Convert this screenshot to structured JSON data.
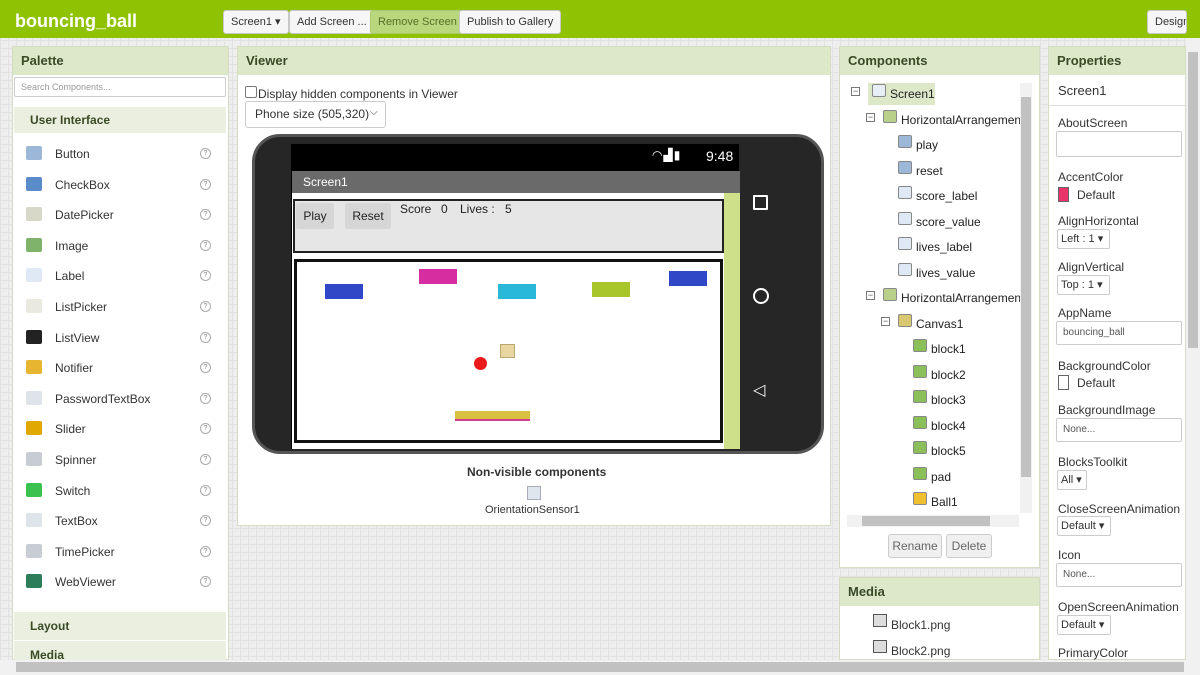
{
  "app": {
    "title": "bouncing_ball",
    "screen_select": "Screen1 ▾",
    "add_screen": "Add Screen ...",
    "remove_screen": "Remove Screen",
    "publish": "Publish to Gallery",
    "designer": "Design"
  },
  "palette": {
    "title": "Palette",
    "search_placeholder": "Search Components...",
    "section": "User Interface",
    "items": [
      {
        "label": "Button",
        "icon": "button-icon",
        "color": "#9db7d9"
      },
      {
        "label": "CheckBox",
        "icon": "checkbox-icon",
        "color": "#5b8cc9"
      },
      {
        "label": "DatePicker",
        "icon": "datepicker-icon",
        "color": "#d8d8c8"
      },
      {
        "label": "Image",
        "icon": "image-icon",
        "color": "#7fb36b"
      },
      {
        "label": "Label",
        "icon": "label-icon",
        "color": "#dfe9f5"
      },
      {
        "label": "ListPicker",
        "icon": "listpicker-icon",
        "color": "#e9e9e0"
      },
      {
        "label": "ListView",
        "icon": "listview-icon",
        "color": "#222222"
      },
      {
        "label": "Notifier",
        "icon": "notifier-icon",
        "color": "#e8b530"
      },
      {
        "label": "PasswordTextBox",
        "icon": "password-icon",
        "color": "#dfe4ea"
      },
      {
        "label": "Slider",
        "icon": "slider-icon",
        "color": "#e0a800"
      },
      {
        "label": "Spinner",
        "icon": "spinner-icon",
        "color": "#c8cdd3"
      },
      {
        "label": "Switch",
        "icon": "switch-icon",
        "color": "#39c24f"
      },
      {
        "label": "TextBox",
        "icon": "textbox-icon",
        "color": "#dfe4ea"
      },
      {
        "label": "TimePicker",
        "icon": "timepicker-icon",
        "color": "#c8cdd3"
      },
      {
        "label": "WebViewer",
        "icon": "webviewer-icon",
        "color": "#2e7d5a"
      }
    ],
    "help_glyph": "?",
    "categories": [
      "Layout",
      "Media"
    ]
  },
  "viewer": {
    "title": "Viewer",
    "checkbox_label": "Display hidden components in Viewer",
    "phone_size": "Phone size (505,320)",
    "status_time": "9:48",
    "screen_title": "Screen1",
    "play": "Play",
    "reset": "Reset",
    "score_label": "Score",
    "score_value": "0",
    "lives_label": "Lives :",
    "lives_value": "5",
    "blocks": [
      {
        "name": "block1",
        "color": "#3048c8"
      },
      {
        "name": "block2",
        "color": "#d62ea0"
      },
      {
        "name": "block3",
        "color": "#2ab8d8"
      },
      {
        "name": "block4",
        "color": "#a8c62a"
      },
      {
        "name": "block5",
        "color": "#3048c8"
      }
    ],
    "ball_color": "#ea1a1a",
    "nonvisible_title": "Non-visible components",
    "orientation_sensor": "OrientationSensor1"
  },
  "components": {
    "title": "Components",
    "tree": [
      {
        "label": "Screen1",
        "level": 0,
        "collapse": "⊟",
        "icon": "screen-icon",
        "selected": true
      },
      {
        "label": "HorizontalArrangemen",
        "level": 1,
        "collapse": "⊟",
        "icon": "arrangement-icon"
      },
      {
        "label": "play",
        "level": 2,
        "icon": "button-icon"
      },
      {
        "label": "reset",
        "level": 2,
        "icon": "button-icon"
      },
      {
        "label": "score_label",
        "level": 2,
        "icon": "label-icon"
      },
      {
        "label": "score_value",
        "level": 2,
        "icon": "label-icon"
      },
      {
        "label": "lives_label",
        "level": 2,
        "icon": "label-icon"
      },
      {
        "label": "lives_value",
        "level": 2,
        "icon": "label-icon"
      },
      {
        "label": "HorizontalArrangemen",
        "level": 1,
        "collapse": "⊟",
        "icon": "arrangement-icon"
      },
      {
        "label": "Canvas1",
        "level": 2,
        "collapse": "⊟",
        "icon": "canvas-icon"
      },
      {
        "label": "block1",
        "level": 3,
        "icon": "sprite-icon"
      },
      {
        "label": "block2",
        "level": 3,
        "icon": "sprite-icon"
      },
      {
        "label": "block3",
        "level": 3,
        "icon": "sprite-icon"
      },
      {
        "label": "block4",
        "level": 3,
        "icon": "sprite-icon"
      },
      {
        "label": "block5",
        "level": 3,
        "icon": "sprite-icon"
      },
      {
        "label": "pad",
        "level": 3,
        "icon": "sprite-icon"
      },
      {
        "label": "Ball1",
        "level": 3,
        "icon": "ball-icon"
      }
    ],
    "rename": "Rename",
    "delete": "Delete"
  },
  "media": {
    "title": "Media",
    "files": [
      "Block1.png",
      "Block2.png"
    ]
  },
  "properties": {
    "title": "Properties",
    "component": "Screen1",
    "about_screen": "AboutScreen",
    "accent_color": "AccentColor",
    "accent_value": "Default",
    "accent_swatch": "#e8336b",
    "align_horizontal": "AlignHorizontal",
    "align_horizontal_value": "Left : 1 ▾",
    "align_vertical": "AlignVertical",
    "align_vertical_value": "Top : 1 ▾",
    "app_name": "AppName",
    "app_name_value": "bouncing_ball",
    "background_color": "BackgroundColor",
    "background_color_value": "Default",
    "background_image": "BackgroundImage",
    "background_image_value": "None...",
    "blocks_toolkit": "BlocksToolkit",
    "blocks_toolkit_value": "All ▾",
    "close_anim": "CloseScreenAnimation",
    "close_anim_value": "Default ▾",
    "icon": "Icon",
    "icon_value": "None...",
    "open_anim": "OpenScreenAnimation",
    "open_anim_value": "Default ▾",
    "primary_color": "PrimaryColor"
  }
}
